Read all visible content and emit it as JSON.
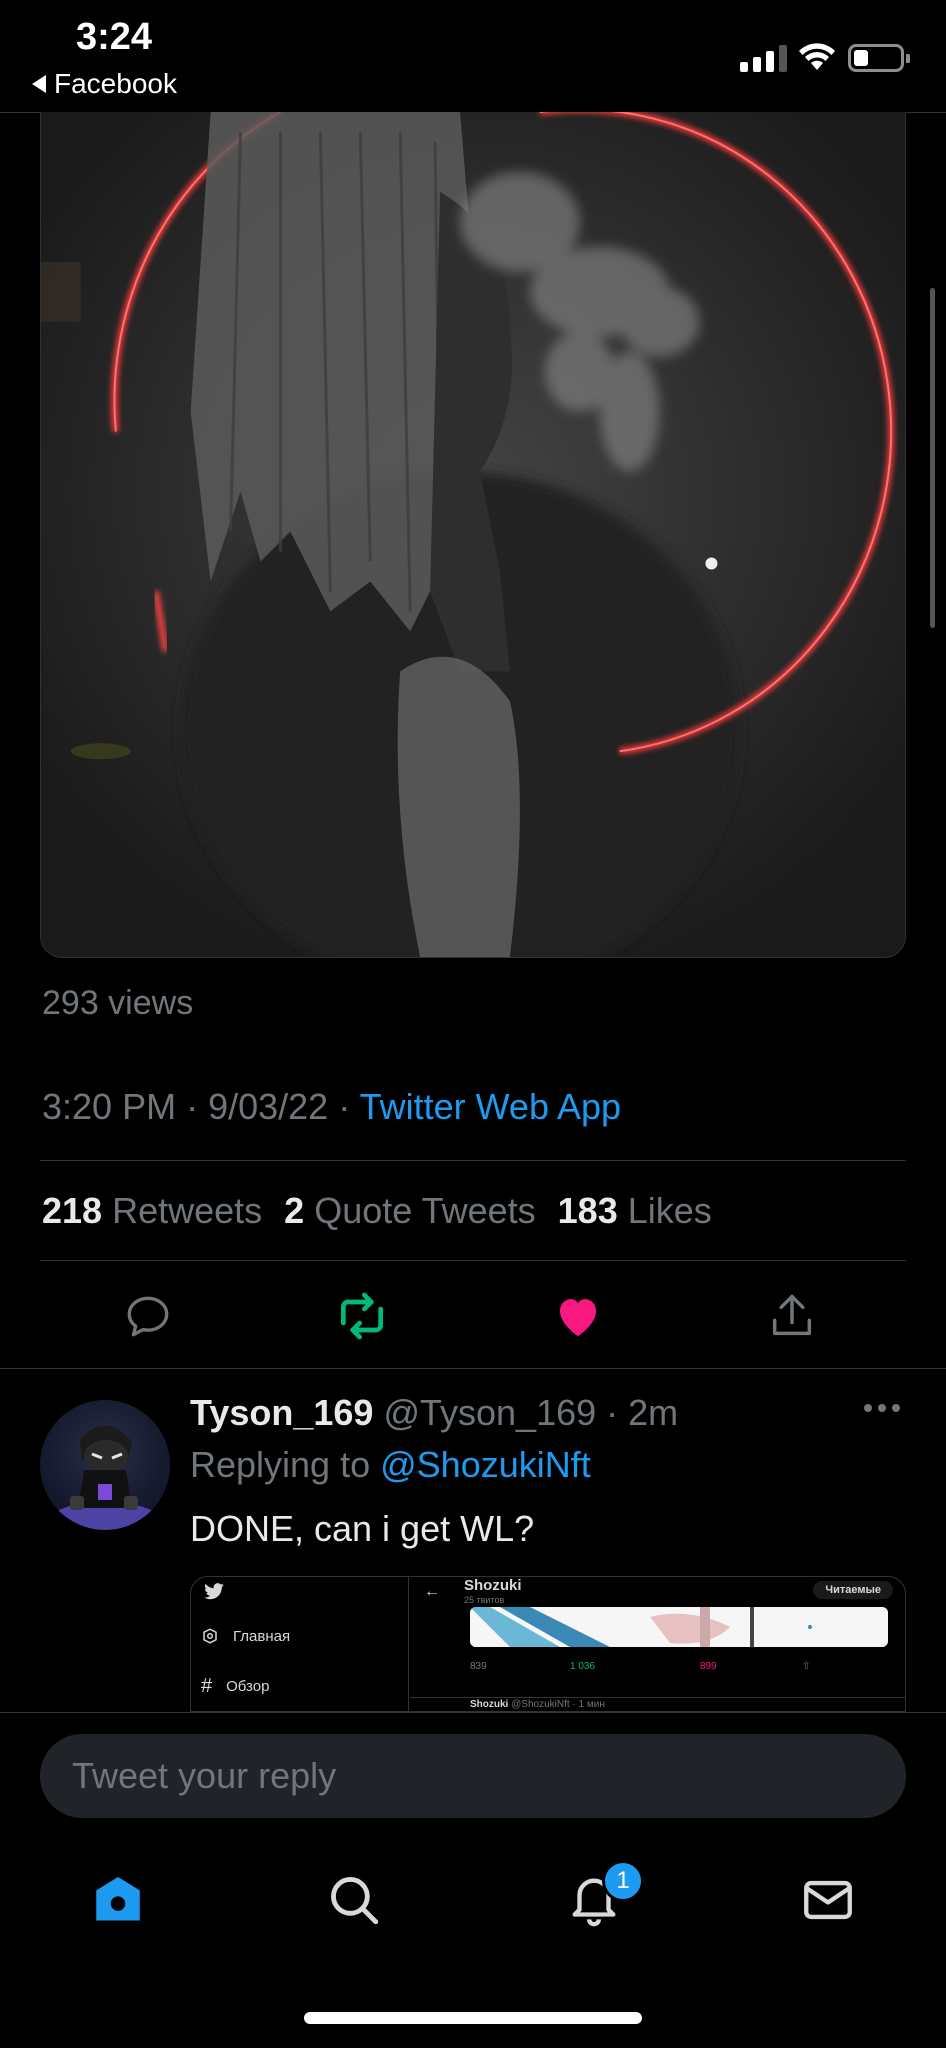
{
  "status_bar": {
    "time": "3:24",
    "back_app": "Facebook",
    "battery_level": 0.25,
    "signal_bars": 3
  },
  "tweet": {
    "views": "293 views",
    "time": "3:20 PM",
    "date": "9/03/22",
    "source": "Twitter Web App",
    "retweets_count": "218",
    "retweets_label": "Retweets",
    "quotes_count": "2",
    "quotes_label": "Quote Tweets",
    "likes_count": "183",
    "likes_label": "Likes",
    "retweeted": true,
    "liked": true
  },
  "actions": [
    {
      "icon": "reply-icon"
    },
    {
      "icon": "retweet-icon",
      "color": "#00ba7c"
    },
    {
      "icon": "like-icon",
      "color": "#f91880"
    },
    {
      "icon": "share-icon"
    }
  ],
  "reply": {
    "name": "Tyson_169",
    "handle": "@Tyson_169",
    "time": "2m",
    "replying_prefix": "Replying to",
    "replying_to": "@ShozukiNft",
    "text": "DONE, can i get WL?",
    "quoted": {
      "nav_home": "Главная",
      "nav_explore": "Обзор",
      "profile_name": "Shozuki",
      "profile_sub": "25 твитов",
      "following_button": "Читаемые",
      "reply_count": "839",
      "retweet_count": "1 036",
      "like_count": "899",
      "footer_name": "Shozuki",
      "footer_handle": "@ShozukiNft · 1 мин"
    }
  },
  "composer": {
    "placeholder": "Tweet your reply"
  },
  "tabbar": {
    "tabs": [
      "home-icon",
      "search-icon",
      "notifications-icon",
      "messages-icon"
    ],
    "notifications_badge": "1"
  },
  "colors": {
    "accent": "#1d9bf0",
    "retweet": "#00ba7c",
    "like": "#f91880",
    "muted": "#71767b"
  }
}
